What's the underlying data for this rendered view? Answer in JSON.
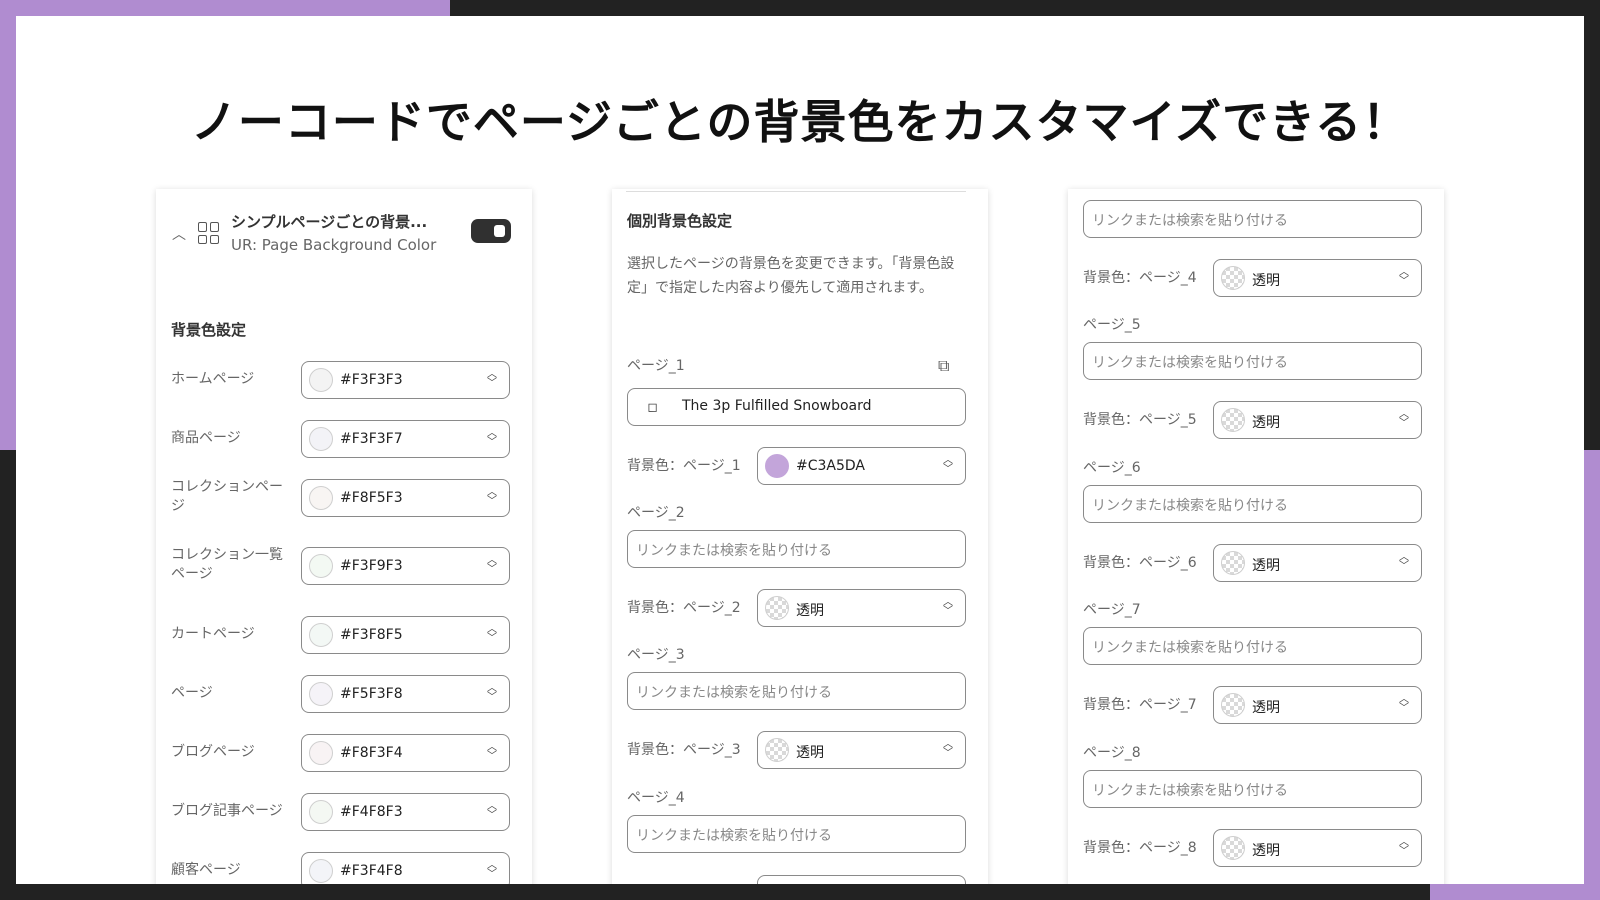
{
  "headline": "ノーコードでページごとの背景色をカスタマイズできる！",
  "colors": {
    "accent_purple": "#B08CD0",
    "dark_frame": "#222222",
    "picked_purple": "#C3A5DA"
  },
  "panel1": {
    "app_title": "シンプルページごとの背景...",
    "app_subtitle": "UR: Page Background Color",
    "section_title": "背景色設定",
    "rows": [
      {
        "label": "ホームページ",
        "value": "#F3F3F3",
        "swatch": "#F3F3F3"
      },
      {
        "label": "商品ページ",
        "value": "#F3F3F7",
        "swatch": "#F3F3F7"
      },
      {
        "label": "コレクションページ",
        "value": "#F8F5F3",
        "swatch": "#F8F5F3"
      },
      {
        "label": "コレクション一覧ページ",
        "value": "#F3F9F3",
        "swatch": "#F3F9F3"
      },
      {
        "label": "カートページ",
        "value": "#F3F8F5",
        "swatch": "#F3F8F5"
      },
      {
        "label": "ページ",
        "value": "#F5F3F8",
        "swatch": "#F5F3F8"
      },
      {
        "label": "ブログページ",
        "value": "#F8F3F4",
        "swatch": "#F8F3F4"
      },
      {
        "label": "ブログ記事ページ",
        "value": "#F4F8F3",
        "swatch": "#F4F8F3"
      },
      {
        "label": "顧客ページ",
        "value": "#F3F4F8",
        "swatch": "#F3F4F8"
      }
    ]
  },
  "panel2": {
    "section_title": "個別背景色設定",
    "description": "選択したページの背景色を変更できます。「背景色設定」で指定した内容より優先して適用されます。",
    "page1_label": "ページ_1",
    "page1_product": "The 3p Fulfilled Snowboard",
    "bg1_label": "背景色：ページ_1",
    "bg1_value": "#C3A5DA",
    "page2_label": "ページ_2",
    "bg2_label": "背景色：ページ_2",
    "page3_label": "ページ_3",
    "bg3_label": "背景色：ページ_3",
    "page4_label": "ページ_4",
    "input_placeholder": "リンクまたは検索を貼り付ける",
    "transparent": "透明"
  },
  "panel3": {
    "input_placeholder": "リンクまたは検索を貼り付ける",
    "transparent": "透明",
    "bg4_label": "背景色：ページ_4",
    "page5_label": "ページ_5",
    "bg5_label": "背景色：ページ_5",
    "page6_label": "ページ_6",
    "bg6_label": "背景色：ページ_6",
    "page7_label": "ページ_7",
    "bg7_label": "背景色：ページ_7",
    "page8_label": "ページ_8",
    "bg8_label": "背景色：ページ_8"
  }
}
